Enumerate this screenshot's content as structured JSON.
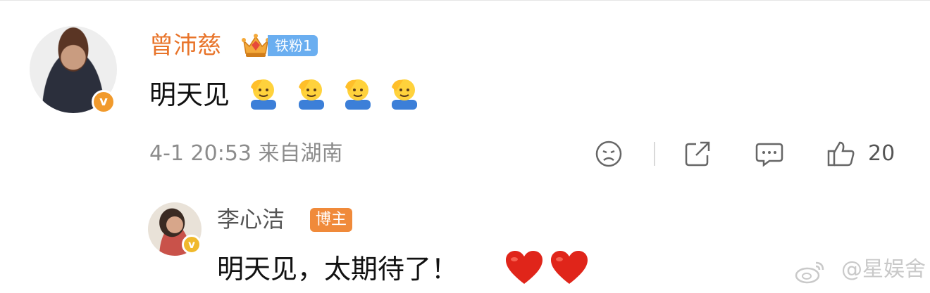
{
  "comment": {
    "username": "曾沛慈",
    "fan_badge": "铁粉1",
    "text": "明天见",
    "emoji_icons": [
      "salute-emoji",
      "salute-emoji",
      "salute-emoji",
      "salute-emoji"
    ],
    "time": "4-1 20:53 来自湖南",
    "like_count": "20",
    "colors": {
      "username": "#e8742a",
      "fan_badge": "#6aaef0",
      "verified": "#f19a2c"
    }
  },
  "reply": {
    "username": "李心洁",
    "badge": "博主",
    "text": "明天见，太期待了！",
    "hearts": [
      "heart-icon",
      "heart-icon"
    ],
    "colors": {
      "badge": "#f08a3a",
      "heart": "#e0251a"
    }
  },
  "watermark": {
    "text": "@星娱舍"
  },
  "icons": {
    "verified": "v",
    "actions": [
      "sad-face-icon",
      "share-icon",
      "comment-icon",
      "thumbs-up-icon"
    ]
  }
}
